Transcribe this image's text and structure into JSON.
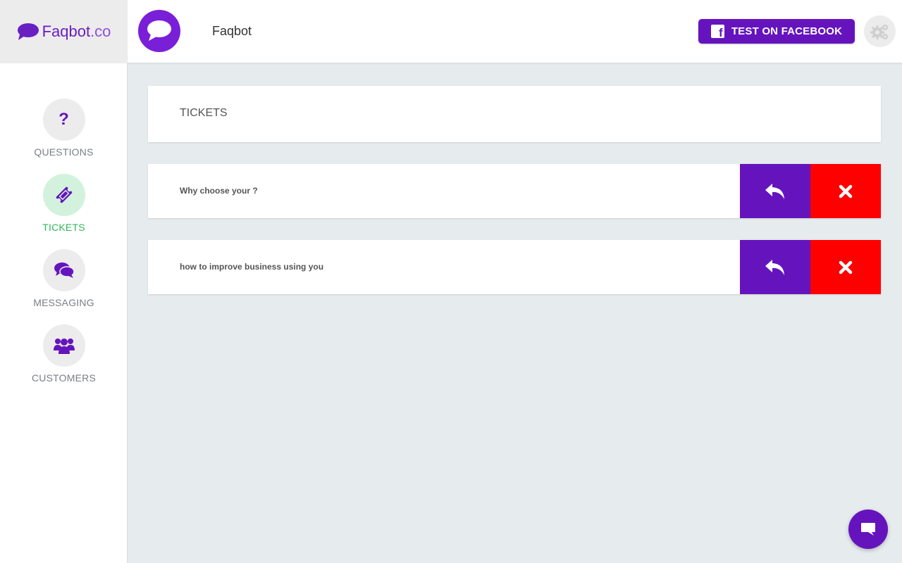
{
  "brand": {
    "name_main": "Faqbot",
    "name_suffix": ".co",
    "primary_color": "#6514bd",
    "danger_color": "#ff0000",
    "active_color": "#2fb85a"
  },
  "header": {
    "bot_name": "Faqbot",
    "fb_button_label": "TEST ON FACEBOOK"
  },
  "sidebar": {
    "items": [
      {
        "label": "QUESTIONS",
        "icon": "question-icon",
        "active": false
      },
      {
        "label": "TICKETS",
        "icon": "ticket-icon",
        "active": true
      },
      {
        "label": "MESSAGING",
        "icon": "chat-bubbles-icon",
        "active": false
      },
      {
        "label": "CUSTOMERS",
        "icon": "users-icon",
        "active": false
      }
    ]
  },
  "main": {
    "title": "TICKETS",
    "tickets": [
      {
        "text": "Why choose your ?"
      },
      {
        "text": "how to improve business using you"
      }
    ]
  }
}
